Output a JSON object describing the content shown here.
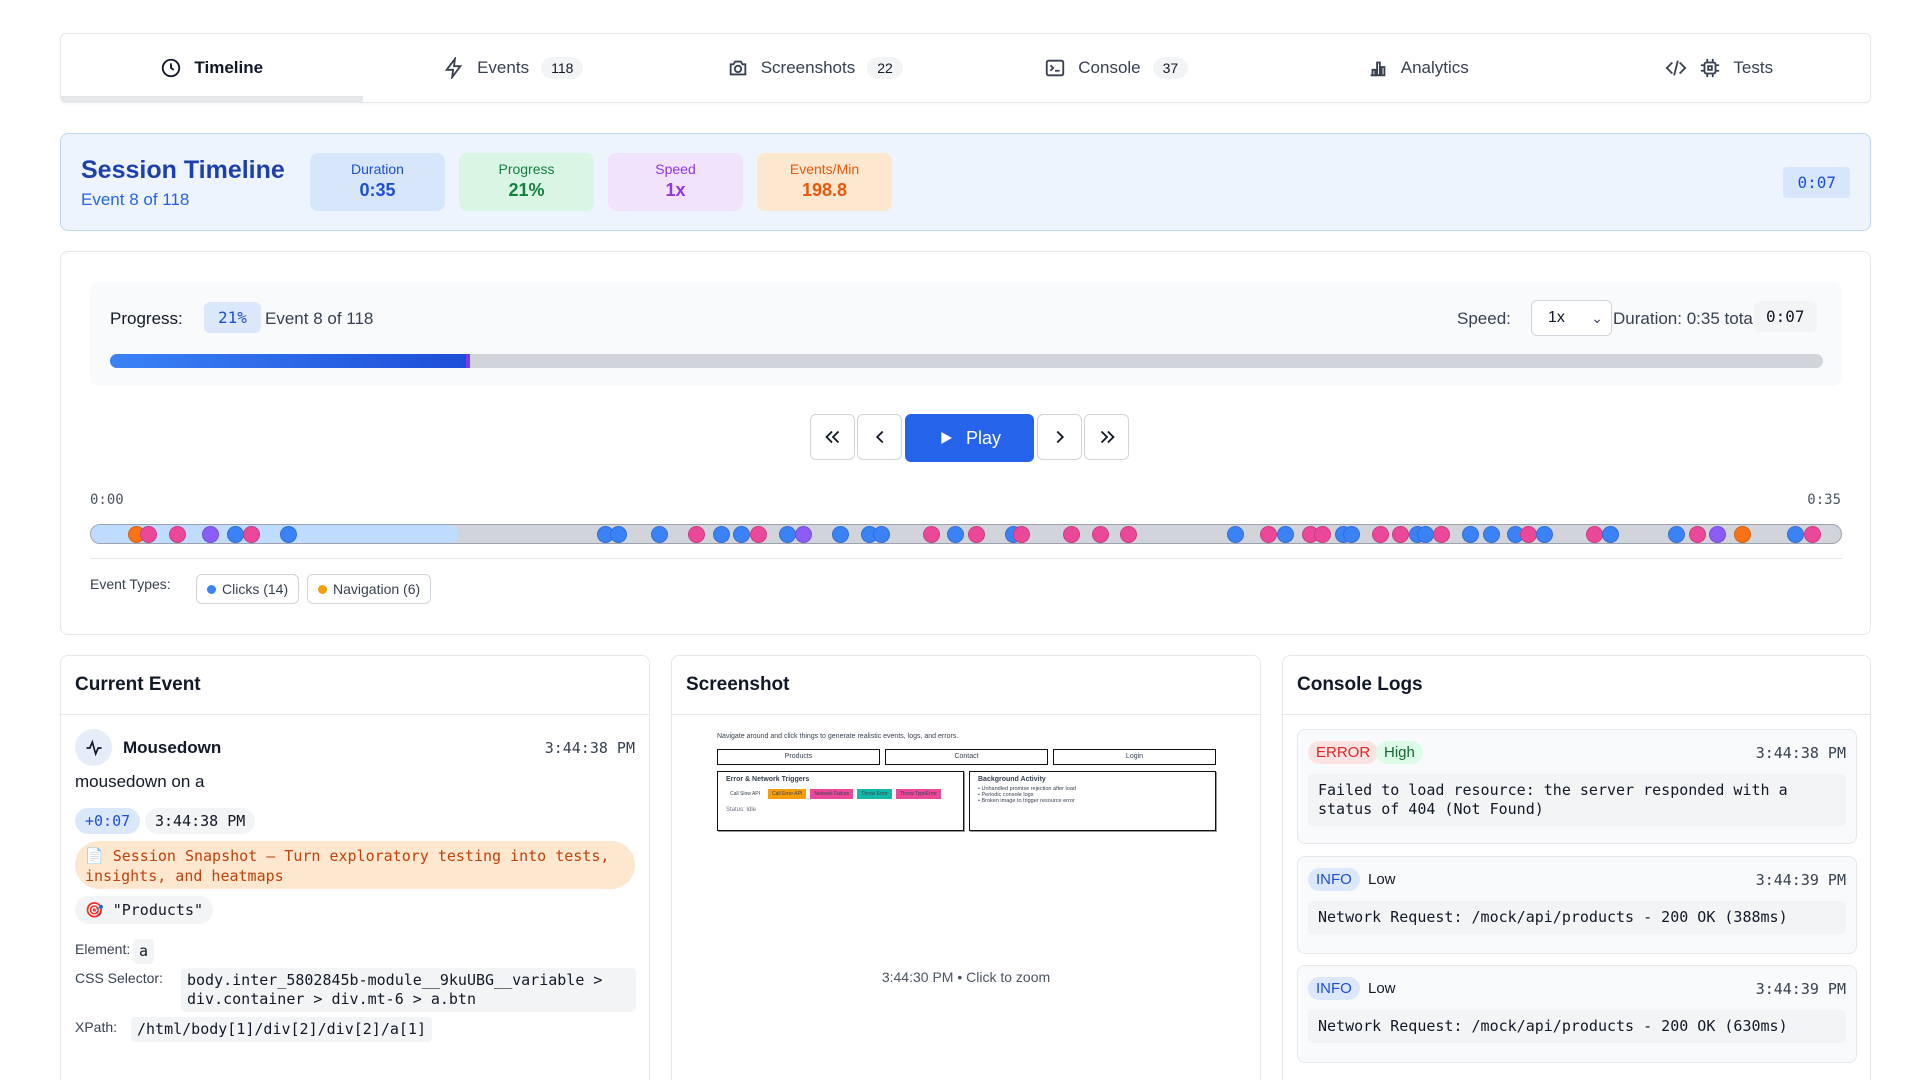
{
  "tabs": [
    {
      "label": "Timeline",
      "icon": "clock-icon",
      "count": null,
      "active": true
    },
    {
      "label": "Events",
      "icon": "bolt-icon",
      "count": "118"
    },
    {
      "label": "Screenshots",
      "icon": "camera-icon",
      "count": "22"
    },
    {
      "label": "Console",
      "icon": "terminal-icon",
      "count": "37"
    },
    {
      "label": "Analytics",
      "icon": "bar-chart-icon",
      "count": null
    },
    {
      "label": "Tests",
      "icon": "code-chip-icon",
      "count": null
    }
  ],
  "session": {
    "title": "Session Timeline",
    "subtitle": "Event 8 of 118",
    "stats": [
      {
        "label": "Duration",
        "value": "0:35",
        "color": "#1d4ed8"
      },
      {
        "label": "Progress",
        "value": "21%",
        "color": "#15803d"
      },
      {
        "label": "Speed",
        "value": "1x",
        "color": "#9333ea"
      },
      {
        "label": "Events/Min",
        "value": "198.8",
        "color": "#ea580c"
      }
    ],
    "current_time": "0:07"
  },
  "player": {
    "progress_label": "Progress:",
    "progress_pct": "21%",
    "progress_fraction": 0.21,
    "event_text": "Event 8 of 118",
    "speed_label": "Speed:",
    "speed_value": "1x",
    "duration_text": "Duration: 0:35 total",
    "current_time": "0:07",
    "play_label": "Play",
    "timeline_start": "0:00",
    "timeline_end": "0:35",
    "timeline_fill_fraction": 0.21,
    "event_types_label": "Event Types:",
    "legend": [
      {
        "label": "Clicks (14)",
        "color": "#3b82f6"
      },
      {
        "label": "Navigation (6)",
        "color": "#f59e0b"
      }
    ],
    "markers": [
      {
        "t": 0.9,
        "c": "#f97316"
      },
      {
        "t": 1.2,
        "c": "#ec4899"
      },
      {
        "t": 1.9,
        "c": "#ec4899"
      },
      {
        "t": 2.7,
        "c": "#8b5cf6"
      },
      {
        "t": 3.3,
        "c": "#3b82f6"
      },
      {
        "t": 3.7,
        "c": "#ec4899"
      },
      {
        "t": 4.6,
        "c": "#3b82f6"
      },
      {
        "t": 12.3,
        "c": "#3b82f6"
      },
      {
        "t": 12.6,
        "c": "#3b82f6"
      },
      {
        "t": 13.6,
        "c": "#3b82f6"
      },
      {
        "t": 14.5,
        "c": "#ec4899"
      },
      {
        "t": 15.1,
        "c": "#3b82f6"
      },
      {
        "t": 15.6,
        "c": "#3b82f6"
      },
      {
        "t": 16.0,
        "c": "#ec4899"
      },
      {
        "t": 16.7,
        "c": "#3b82f6"
      },
      {
        "t": 17.1,
        "c": "#8b5cf6"
      },
      {
        "t": 18.0,
        "c": "#3b82f6"
      },
      {
        "t": 18.7,
        "c": "#3b82f6"
      },
      {
        "t": 19.0,
        "c": "#3b82f6"
      },
      {
        "t": 20.2,
        "c": "#ec4899"
      },
      {
        "t": 20.8,
        "c": "#3b82f6"
      },
      {
        "t": 21.3,
        "c": "#ec4899"
      },
      {
        "t": 22.2,
        "c": "#3b82f6"
      },
      {
        "t": 22.4,
        "c": "#ec4899"
      },
      {
        "t": 23.6,
        "c": "#ec4899"
      },
      {
        "t": 24.3,
        "c": "#ec4899"
      },
      {
        "t": 25.0,
        "c": "#ec4899"
      },
      {
        "t": 27.6,
        "c": "#3b82f6"
      },
      {
        "t": 28.4,
        "c": "#ec4899"
      },
      {
        "t": 28.8,
        "c": "#3b82f6"
      },
      {
        "t": 29.4,
        "c": "#ec4899"
      },
      {
        "t": 29.7,
        "c": "#ec4899"
      },
      {
        "t": 30.2,
        "c": "#3b82f6"
      },
      {
        "t": 30.4,
        "c": "#3b82f6"
      },
      {
        "t": 31.1,
        "c": "#ec4899"
      },
      {
        "t": 31.6,
        "c": "#ec4899"
      },
      {
        "t": 32.0,
        "c": "#3b82f6"
      },
      {
        "t": 32.2,
        "c": "#3b82f6"
      },
      {
        "t": 32.6,
        "c": "#ec4899"
      },
      {
        "t": 33.3,
        "c": "#3b82f6"
      },
      {
        "t": 33.8,
        "c": "#3b82f6"
      },
      {
        "t": 34.4,
        "c": "#3b82f6"
      },
      {
        "t": 34.7,
        "c": "#ec4899"
      },
      {
        "t": 35.1,
        "c": "#3b82f6"
      },
      {
        "t": 36.3,
        "c": "#ec4899"
      },
      {
        "t": 36.7,
        "c": "#3b82f6"
      },
      {
        "t": 38.3,
        "c": "#3b82f6"
      },
      {
        "t": 38.8,
        "c": "#ec4899"
      },
      {
        "t": 39.3,
        "c": "#8b5cf6"
      },
      {
        "t": 39.9,
        "c": "#f97316"
      },
      {
        "t": 41.2,
        "c": "#3b82f6"
      },
      {
        "t": 41.6,
        "c": "#ec4899"
      }
    ]
  },
  "current_event": {
    "title": "Current Event",
    "event_name": "Mousedown",
    "time": "3:44:38 PM",
    "description": "mousedown on a",
    "relative_time": "+0:07",
    "absolute_time": "3:44:38 PM",
    "snapshot": "📄 Session Snapshot — Turn exploratory testing into tests, insights, and heatmaps",
    "target_text": "🎯 \"Products\"",
    "element_label": "Element:",
    "element_value": "a",
    "css_label": "CSS Selector:",
    "css_value": "body.inter_5802845b-module__9kuUBG__variable > div.container > div.mt-6 > a.btn",
    "xpath_label": "XPath:",
    "xpath_value": "/html/body[1]/div[2]/div[2]/a[1]"
  },
  "screenshot": {
    "title": "Screenshot",
    "caption": "3:44:30 PM • Click to zoom",
    "mini": {
      "intro": "Navigate around and click things to generate realistic events, logs, and errors.",
      "nav": [
        "Products",
        "Contact",
        "Login"
      ],
      "box1_title": "Error & Network Triggers",
      "box1_buttons": [
        {
          "label": "Call Slow API",
          "color": "#ffffff"
        },
        {
          "label": "Call Error API",
          "color": "#f59e0b"
        },
        {
          "label": "Network Failure",
          "color": "#ec4899"
        },
        {
          "label": "Throw Error",
          "color": "#14b8a6"
        },
        {
          "label": "Throw TypeError",
          "color": "#ec4899"
        }
      ],
      "box1_status": "Status: Idle",
      "box2_title": "Background Activity",
      "box2_items": [
        "Unhandled promise rejection after load",
        "Periodic console logs",
        "Broken image to trigger resource error"
      ]
    }
  },
  "console": {
    "title": "Console Logs",
    "logs": [
      {
        "level": "ERROR",
        "priority": "High",
        "time": "3:44:38 PM",
        "message": "Failed to load resource: the server responded with a status of 404 (Not Found)"
      },
      {
        "level": "INFO",
        "priority": "Low",
        "time": "3:44:39 PM",
        "message": "Network Request: /mock/api/products - 200 OK (388ms)"
      },
      {
        "level": "INFO",
        "priority": "Low",
        "time": "3:44:39 PM",
        "message": "Network Request: /mock/api/products - 200 OK (630ms)"
      }
    ]
  }
}
